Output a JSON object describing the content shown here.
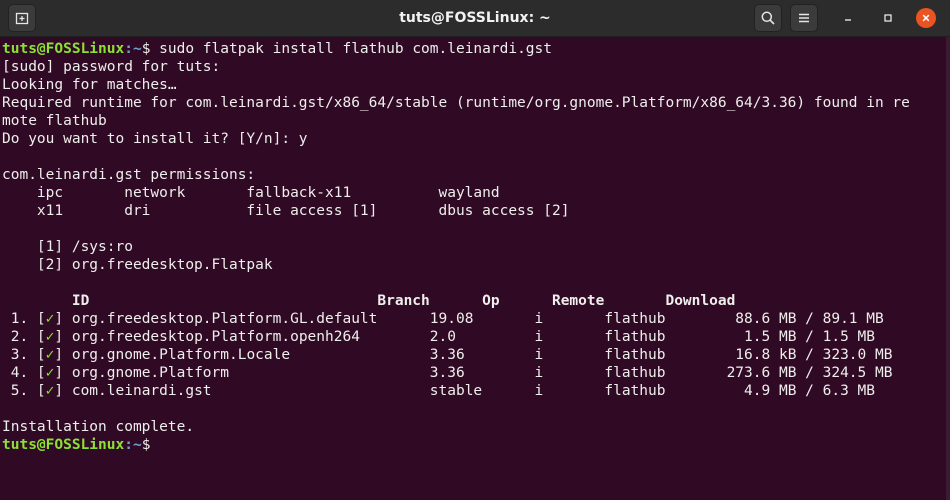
{
  "window": {
    "title": "tuts@FOSSLinux: ~"
  },
  "prompt": {
    "user_host": "tuts@FOSSLinux",
    "path": ":~",
    "symbol": "$"
  },
  "terminal": {
    "command": " sudo flatpak install flathub com.leinardi.gst",
    "sudo_prompt": "[sudo] password for tuts:",
    "looking": "Looking for matches…",
    "required_1": "Required runtime for com.leinardi.gst/x86_64/stable (runtime/org.gnome.Platform/x86_64/3.36) found in re",
    "required_2": "mote flathub",
    "question": "Do you want to install it? [Y/n]: y",
    "permissions_title": "com.leinardi.gst permissions:",
    "perm_row_1": "    ipc       network       fallback-x11          wayland",
    "perm_row_2": "    x11       dri           file access [1]       dbus access [2]",
    "ref_1": "    [1] /sys:ro",
    "ref_2": "    [2] org.freedesktop.Flatpak",
    "table_header": "        ID                                 Branch      Op      Remote       Download",
    "rows": [
      {
        "num": " 1. [",
        "check": "✓",
        "rest": "] org.freedesktop.Platform.GL.default      19.08       i       flathub        88.6 MB / 89.1 MB"
      },
      {
        "num": " 2. [",
        "check": "✓",
        "rest": "] org.freedesktop.Platform.openh264        2.0         i       flathub         1.5 MB / 1.5 MB"
      },
      {
        "num": " 3. [",
        "check": "✓",
        "rest": "] org.gnome.Platform.Locale                3.36        i       flathub        16.8 kB / 323.0 MB"
      },
      {
        "num": " 4. [",
        "check": "✓",
        "rest": "] org.gnome.Platform                       3.36        i       flathub       273.6 MB / 324.5 MB"
      },
      {
        "num": " 5. [",
        "check": "✓",
        "rest": "] com.leinardi.gst                         stable      i       flathub         4.9 MB / 6.3 MB"
      }
    ],
    "complete": "Installation complete."
  },
  "colors": {
    "background": "#300a24",
    "prompt_user": "#8ae234",
    "prompt_path": "#729fcf",
    "close_button": "#e95420"
  },
  "icons": {
    "new_tab": "new-tab-icon",
    "search": "search-icon",
    "menu": "hamburger-menu-icon",
    "minimize": "minimize-icon",
    "maximize": "maximize-icon",
    "close": "close-icon"
  }
}
